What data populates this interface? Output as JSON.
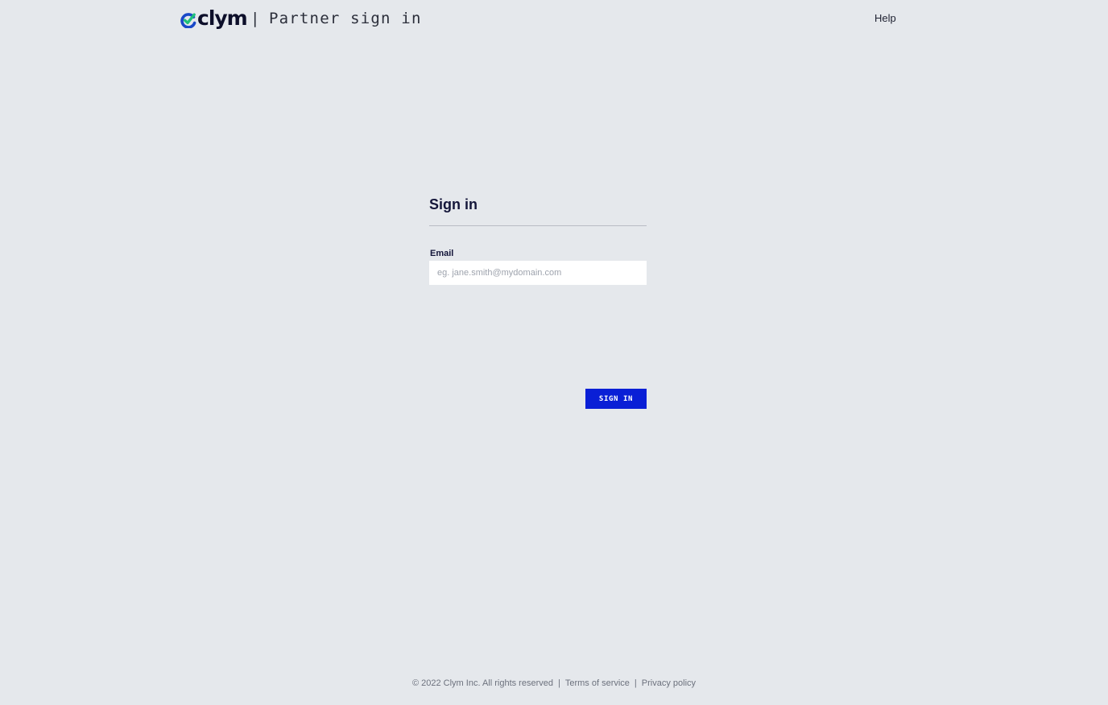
{
  "header": {
    "logo_text": "clym",
    "separator": "|",
    "title": "Partner sign in",
    "help_label": "Help"
  },
  "form": {
    "title": "Sign in",
    "email_label": "Email",
    "email_placeholder": "eg. jane.smith@mydomain.com",
    "email_value": "",
    "submit_label": "SIGN IN"
  },
  "footer": {
    "copyright": "© 2022 Clym Inc. All rights reserved",
    "separator": "|",
    "terms_label": "Terms of service",
    "privacy_label": "Privacy policy"
  },
  "colors": {
    "background": "#e5e8ec",
    "accent": "#0a1fd6",
    "logo_green": "#1fc07a",
    "logo_blue": "#1a49c8",
    "heading": "#14163a"
  },
  "icons": {
    "logo_mark": "clym-check-logo-icon"
  }
}
